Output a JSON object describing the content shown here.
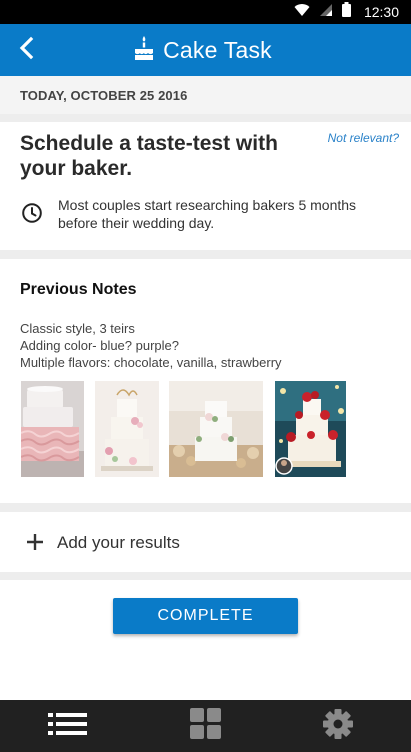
{
  "status_bar": {
    "time": "12:30"
  },
  "app_bar": {
    "title": "Cake Task"
  },
  "date": {
    "text": "TODAY, OCTOBER 25 2016"
  },
  "task": {
    "title": "Schedule a taste-test with your baker.",
    "not_relevant_label": "Not relevant?",
    "tip": "Most couples start researching bakers 5 months before their wedding day."
  },
  "notes": {
    "heading": "Previous Notes",
    "lines": [
      "Classic style, 3 teirs",
      "Adding color- blue?  purple?",
      "Multiple flavors: chocolate, vanilla, strawberry"
    ]
  },
  "add_results": {
    "label": "Add your results"
  },
  "complete": {
    "label": "COMPLETE"
  },
  "colors": {
    "primary": "#0a7bc8",
    "link": "#2a82c9",
    "nav_bg": "#212121"
  },
  "icons": [
    "wifi-icon",
    "signal-icon",
    "battery-icon",
    "back-arrow-icon",
    "cake-icon",
    "clock-icon",
    "plus-icon",
    "list-icon",
    "grid-icon",
    "settings-icon"
  ]
}
